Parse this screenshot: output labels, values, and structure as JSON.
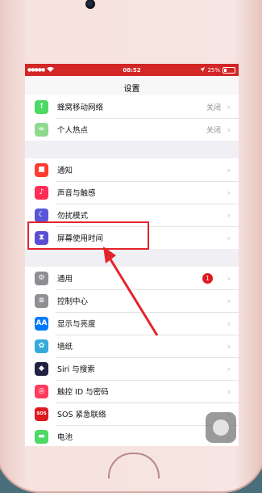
{
  "status_bar": {
    "signal": "●●●●●",
    "time": "08:52",
    "battery": "25%",
    "battery_level": 0.25
  },
  "nav": {
    "title": "设置"
  },
  "groups": [
    [
      {
        "label": "蜂窝移动网络",
        "value": "关闭",
        "icon": "antenna-icon",
        "color": "#4cd964"
      },
      {
        "label": "个人热点",
        "value": "关闭",
        "icon": "hotspot-icon",
        "color": "#8fd98f"
      }
    ],
    [
      {
        "label": "通知",
        "value": "",
        "icon": "notifications-icon",
        "color": "#ff3b30"
      },
      {
        "label": "声音与触感",
        "value": "",
        "icon": "sound-icon",
        "color": "#ff2d55"
      },
      {
        "label": "勿扰模式",
        "value": "",
        "icon": "moon-icon",
        "color": "#5856d6"
      },
      {
        "label": "屏幕使用时间",
        "value": "",
        "icon": "hourglass-icon",
        "color": "#5b4fd1"
      }
    ],
    [
      {
        "label": "通用",
        "value": "",
        "icon": "gear-icon",
        "color": "#8e8e93",
        "badge": "1"
      },
      {
        "label": "控制中心",
        "value": "",
        "icon": "control-center-icon",
        "color": "#8e8e93"
      },
      {
        "label": "显示与亮度",
        "value": "",
        "icon": "display-icon",
        "color": "#007aff"
      },
      {
        "label": "墙纸",
        "value": "",
        "icon": "wallpaper-icon",
        "color": "#34aadc"
      },
      {
        "label": "Siri 与搜索",
        "value": "",
        "icon": "siri-icon",
        "color": "#222244"
      },
      {
        "label": "触控 ID 与密码",
        "value": "",
        "icon": "fingerprint-icon",
        "color": "#ff3b5c"
      },
      {
        "label": "SOS 紧急联络",
        "value": "",
        "icon": "sos-icon",
        "color": "#e0181f"
      },
      {
        "label": "电池",
        "value": "",
        "icon": "battery-icon",
        "color": "#4cd964"
      }
    ]
  ],
  "glyphs": {
    "antenna-icon": "↑",
    "hotspot-icon": "∞",
    "notifications-icon": "■",
    "sound-icon": "♪",
    "moon-icon": "☾",
    "hourglass-icon": "⧗",
    "gear-icon": "⚙",
    "control-center-icon": "≡",
    "display-icon": "AA",
    "wallpaper-icon": "✿",
    "siri-icon": "◆",
    "fingerprint-icon": "◎",
    "sos-icon": "SOS",
    "battery-icon": "▬"
  }
}
